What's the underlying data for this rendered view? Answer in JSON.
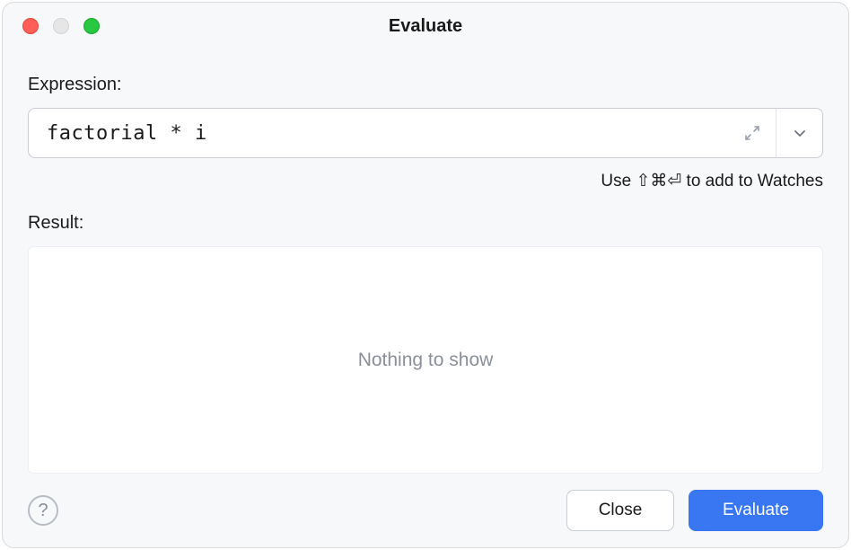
{
  "window": {
    "title": "Evaluate"
  },
  "expression": {
    "label": "Expression:",
    "value": "factorial * i"
  },
  "hint": {
    "prefix": "Use ",
    "shortcut": "⇧⌘⏎",
    "suffix": " to add to Watches"
  },
  "result": {
    "label": "Result:",
    "placeholder": "Nothing to show"
  },
  "buttons": {
    "close": "Close",
    "evaluate": "Evaluate"
  }
}
